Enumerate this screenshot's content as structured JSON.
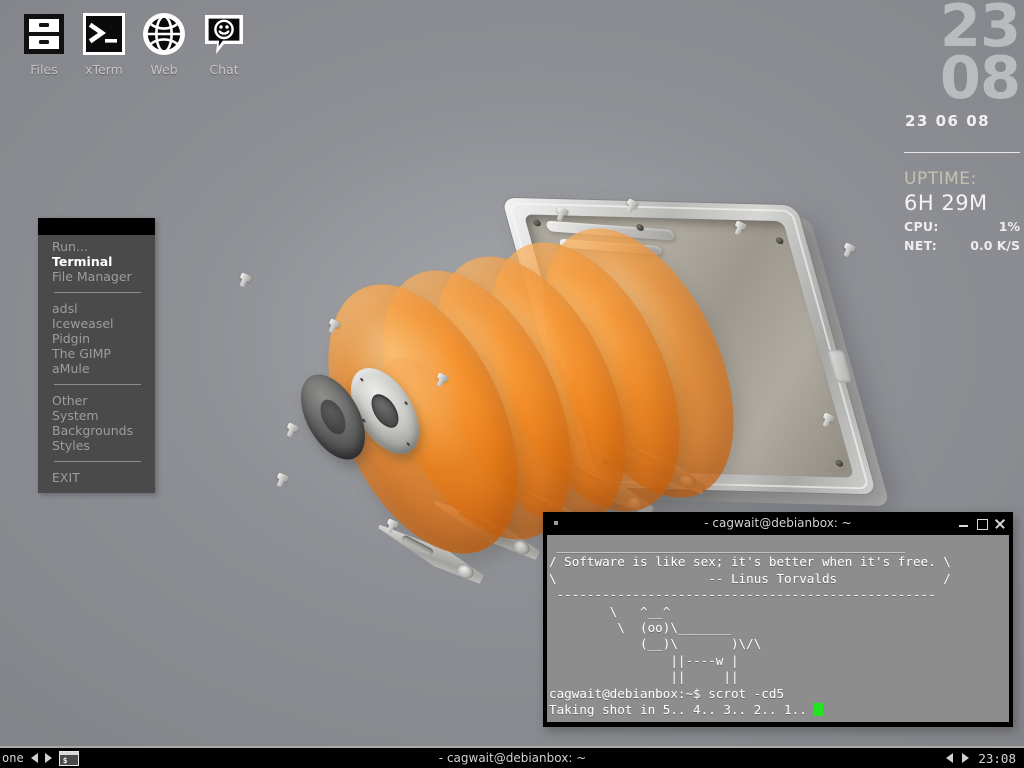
{
  "desktop": {
    "background_color": "#8c8e93",
    "wallpaper_description": "exploded-view 3D render of a hard disk drive with orange translucent platters"
  },
  "dock": {
    "items": [
      {
        "label": "Files",
        "icon": "file-cabinet-icon"
      },
      {
        "label": "xTerm",
        "icon": "terminal-prompt-icon"
      },
      {
        "label": "Web",
        "icon": "globe-icon"
      },
      {
        "label": "Chat",
        "icon": "smiley-speech-bubble-icon"
      }
    ]
  },
  "root_menu": {
    "title": "",
    "groups": [
      [
        {
          "label": "Run...",
          "active": false
        },
        {
          "label": "Terminal",
          "active": true
        },
        {
          "label": "File Manager",
          "active": false
        }
      ],
      [
        {
          "label": "adsl",
          "active": false
        },
        {
          "label": "Iceweasel",
          "active": false
        },
        {
          "label": "Pidgin",
          "active": false
        },
        {
          "label": "The GIMP",
          "active": false
        },
        {
          "label": "aMule",
          "active": false
        }
      ],
      [
        {
          "label": "Other",
          "active": false
        },
        {
          "label": "System",
          "active": false
        },
        {
          "label": "Backgrounds",
          "active": false
        },
        {
          "label": "Styles",
          "active": false
        }
      ],
      [
        {
          "label": "EXIT",
          "active": false
        }
      ]
    ]
  },
  "conky": {
    "hours": "23",
    "minutes": "08",
    "date": "23 06 08",
    "uptime_label": "UPTIME:",
    "uptime_value": "6H 29M",
    "cpu_label": "CPU:",
    "cpu_value": "1%",
    "net_label": "NET:",
    "net_value": "0.0 K/S"
  },
  "terminal": {
    "title": "- cagwait@debianbox: ~",
    "minimize_label": "minimize-icon",
    "maximize_label": "maximize-icon",
    "close_label": "close-icon",
    "content": " ______________________________________________\n/ Software is like sex; it's better when it's free. \\\n\\                    -- Linus Torvalds              /\n --------------------------------------------------\n        \\   ^__^\n         \\  (oo)\\_______\n            (__)\\       )\\/\\\n                ||----w |\n                ||     ||",
    "prompt_line": "cagwait@debianbox:~$ scrot -cd5",
    "output_line": "Taking shot in 5.. 4.. 3.. 2.. 1.. "
  },
  "taskbar": {
    "workspace_name": "one",
    "prev_label": "previous-workspace",
    "next_label": "next-workspace",
    "window_icon_label": "terminal-window-icon",
    "active_window_title": "- cagwait@debianbox: ~",
    "clock": "23:08"
  }
}
